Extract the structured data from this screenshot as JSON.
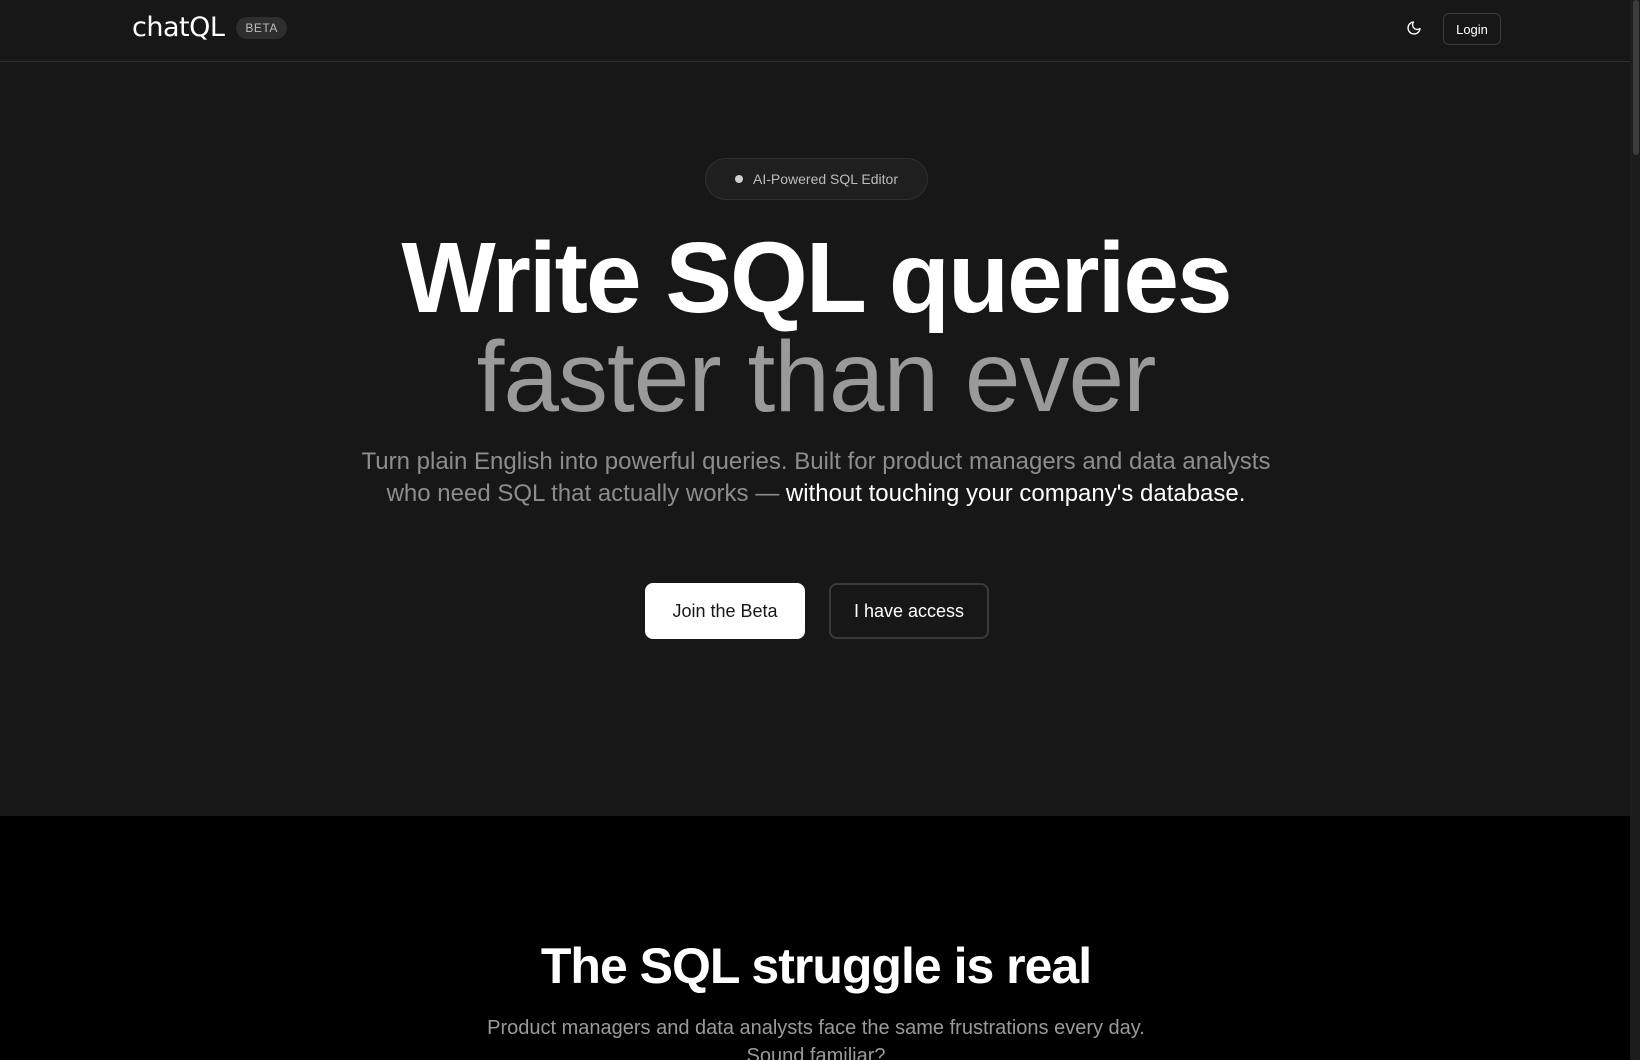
{
  "header": {
    "logo": "chatQL",
    "badge": "BETA",
    "theme_toggle_icon": "moon-icon",
    "login_label": "Login"
  },
  "hero": {
    "badge_label": "AI-Powered SQL Editor",
    "headline_line1": "Write SQL queries",
    "headline_line2": "faster than ever",
    "subtext_plain": "Turn plain English into powerful queries. Built for product managers and data analysts who need SQL that actually works — ",
    "subtext_highlight": "without touching your company's database.",
    "primary_cta": "Join the Beta",
    "secondary_cta": "I have access"
  },
  "struggle": {
    "title": "The SQL struggle is real",
    "subtitle": "Product managers and data analysts face the same frustrations every day. Sound familiar?"
  },
  "colors": {
    "background": "#171717",
    "section_dark": "#000000",
    "text_primary": "#ffffff",
    "text_muted": "#9a9a9a"
  }
}
